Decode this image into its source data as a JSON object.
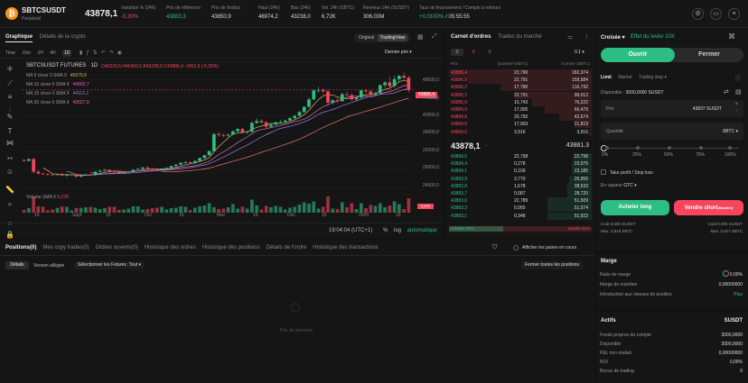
{
  "header": {
    "symbol": "SBTCSUSDT",
    "subtitle": "Perpetuel",
    "last_price": "43878,1",
    "stats": [
      {
        "label": "Variation % (24h)",
        "value": "-5,30%",
        "color": "#f6465d"
      },
      {
        "label": "Prix de référence",
        "value": "43883,3",
        "color": "#2ebd85"
      },
      {
        "label": "Prix de l'indice",
        "value": "43850,9",
        "color": "#dddddd"
      },
      {
        "label": "Haut (24h)",
        "value": "46974,2",
        "color": "#dddddd"
      },
      {
        "label": "Bas (24h)",
        "value": "43238,0",
        "color": "#dddddd"
      },
      {
        "label": "Vol. 24h (SBTC)",
        "value": "6,72K",
        "color": "#dddddd"
      },
      {
        "label": "Revenus 24h (SUSDT)",
        "value": "306,03M",
        "color": "#dddddd"
      },
      {
        "label": "Taux de financement / Compte à rebours",
        "value_rate": "+0,0100%",
        "value_timer": "/ 05:55:55"
      }
    ]
  },
  "chart_panel": {
    "tabs": [
      "Graphique",
      "Détails de la crypto"
    ],
    "views": [
      "Original",
      "TradingView"
    ],
    "intervals": [
      "Time",
      "15m",
      "1H",
      "4H",
      "1D"
    ],
    "last_price_mode": "Dernier prix",
    "legend_title": "SBTCSUSDT FUTURES · 1D",
    "ohlc": "O46239,5  H46493,5  B43238,0  C43886,4  -2452,9 (-5,29%)",
    "ma": [
      {
        "label": "MA 5 close 0 SMA 9",
        "value": "45979,9",
        "color": "#e0b252"
      },
      {
        "label": "MA 10 close 0 SMA 9",
        "value": "44892,7",
        "color": "#d96cb5"
      },
      {
        "label": "MA 15 close 0 SMA 9",
        "value": "44112,1",
        "color": "#9b7ce0"
      },
      {
        "label": "MA 30 close 0 SMA 9",
        "value": "43027,9",
        "color": "#f0756e"
      }
    ],
    "volume_label": "Volume SMA 9",
    "volume_value": "5,37K",
    "price_tag": "43886,4",
    "yticks": [
      "48000,0",
      "44000,0",
      "40000,0",
      "36000,0",
      "32000,0",
      "28000,0",
      "24000,0"
    ],
    "xticks": [
      "15",
      "Sept",
      "15",
      "Oct",
      "15",
      "Nov",
      "15",
      "Déc",
      "15",
      "2024",
      "15"
    ],
    "time": "19:04:04 (UTC+1)",
    "controls": [
      "%",
      "log",
      "automatique"
    ]
  },
  "chart_data": {
    "type": "candlestick",
    "candles": [
      [
        29000,
        29100,
        28600,
        28800
      ],
      [
        28800,
        29300,
        28700,
        29200
      ],
      [
        29200,
        29400,
        26100,
        26500
      ],
      [
        26500,
        26800,
        25900,
        26100
      ],
      [
        26100,
        26300,
        25800,
        26000
      ],
      [
        26000,
        26200,
        25700,
        25900
      ],
      [
        25900,
        26100,
        25600,
        25800
      ],
      [
        25800,
        26100,
        25700,
        26050
      ],
      [
        26050,
        26200,
        25600,
        25700
      ],
      [
        25700,
        26000,
        25400,
        25800
      ],
      [
        25800,
        26000,
        25700,
        25900
      ],
      [
        25900,
        26000,
        25300,
        25450
      ],
      [
        25450,
        25800,
        25300,
        25700
      ],
      [
        25700,
        26000,
        25600,
        25900
      ],
      [
        25900,
        26100,
        25700,
        25800
      ],
      [
        25800,
        26600,
        25700,
        26500
      ],
      [
        26500,
        26900,
        26300,
        26700
      ],
      [
        26700,
        27100,
        26500,
        26900
      ],
      [
        26900,
        27000,
        26400,
        26600
      ],
      [
        26600,
        26800,
        26300,
        26500
      ],
      [
        26500,
        26700,
        26200,
        26300
      ],
      [
        26300,
        26500,
        26100,
        26400
      ],
      [
        26400,
        26600,
        26300,
        26500
      ],
      [
        26500,
        27000,
        26400,
        26900
      ],
      [
        26900,
        27300,
        26800,
        27100
      ],
      [
        27100,
        27500,
        26900,
        27400
      ],
      [
        27400,
        27700,
        27100,
        27200
      ],
      [
        27200,
        27400,
        26900,
        27000
      ],
      [
        27000,
        27200,
        26700,
        26900
      ],
      [
        26900,
        27100,
        26800,
        27000
      ],
      [
        27000,
        27400,
        26900,
        27300
      ],
      [
        27300,
        27800,
        27200,
        27700
      ],
      [
        27700,
        28100,
        27600,
        28000
      ],
      [
        28000,
        28500,
        27900,
        28400
      ],
      [
        28400,
        28800,
        28200,
        28500
      ],
      [
        28500,
        28700,
        28100,
        28300
      ],
      [
        28300,
        28900,
        28200,
        28800
      ],
      [
        28800,
        29500,
        28700,
        29400
      ],
      [
        29400,
        30100,
        29300,
        30000
      ],
      [
        30000,
        31000,
        29900,
        30900
      ],
      [
        30900,
        34800,
        30800,
        34500
      ],
      [
        34500,
        35000,
        33900,
        34300
      ],
      [
        34300,
        34700,
        33800,
        34200
      ],
      [
        34200,
        34600,
        33900,
        34400
      ],
      [
        34400,
        35300,
        34300,
        35100
      ],
      [
        35100,
        35800,
        34900,
        35600
      ],
      [
        35600,
        35800,
        34700,
        34900
      ],
      [
        34900,
        35200,
        34500,
        35000
      ],
      [
        35000,
        37200,
        34900,
        36900
      ],
      [
        36900,
        37900,
        36600,
        37300
      ],
      [
        37300,
        37700,
        36800,
        37000
      ],
      [
        37000,
        37300,
        35600,
        36100
      ],
      [
        36100,
        36700,
        35800,
        36500
      ],
      [
        36500,
        37200,
        36300,
        37000
      ],
      [
        37000,
        37500,
        36700,
        37100
      ],
      [
        37100,
        37600,
        36900,
        37400
      ],
      [
        37400,
        38200,
        37200,
        37900
      ],
      [
        37900,
        38600,
        37700,
        38400
      ],
      [
        38400,
        39400,
        38200,
        39200
      ],
      [
        39200,
        40500,
        39000,
        40300
      ],
      [
        40300,
        42300,
        40100,
        41900
      ],
      [
        41900,
        44100,
        41700,
        43800
      ],
      [
        43800,
        44600,
        43300,
        43900
      ],
      [
        43900,
        44300,
        43200,
        43600
      ],
      [
        43600,
        44000,
        40500,
        41200
      ],
      [
        41200,
        42000,
        40800,
        41700
      ],
      [
        41700,
        42200,
        41100,
        41500
      ],
      [
        41500,
        43300,
        41400,
        43000
      ],
      [
        43000,
        43600,
        42600,
        42800
      ],
      [
        42800,
        43200,
        41500,
        41900
      ],
      [
        41900,
        42500,
        41600,
        42300
      ],
      [
        42300,
        44000,
        42100,
        43800
      ],
      [
        43800,
        44100,
        43200,
        43600
      ],
      [
        43600,
        43900,
        42600,
        42900
      ],
      [
        42900,
        43500,
        42700,
        43200
      ],
      [
        43200,
        45200,
        43000,
        44900
      ],
      [
        44900,
        45800,
        44300,
        45500
      ],
      [
        45500,
        46800,
        44200,
        44700
      ],
      [
        44700,
        47000,
        44400,
        46200
      ],
      [
        46200,
        47200,
        45500,
        46900
      ],
      [
        46900,
        47600,
        46300,
        46500
      ],
      [
        46500,
        46900,
        43300,
        43900
      ]
    ],
    "ylim": [
      22000,
      50000
    ]
  },
  "orderbook": {
    "tabs": [
      "Carnet d'ordres",
      "Trades du marché"
    ],
    "precision": "0.1",
    "headers": [
      "Prix",
      "Quantité (SBTC)",
      "Somme (SBTC)"
    ],
    "asks": [
      [
        "43888,4",
        "22,790",
        "182,374",
        1.0
      ],
      [
        "43886,9",
        "22,791",
        "159,584",
        0.87
      ],
      [
        "43886,2",
        "17,780",
        "116,792",
        0.64
      ],
      [
        "43885,1",
        "22,791",
        "99,012",
        0.54
      ],
      [
        "43885,0",
        "15,743",
        "76,222",
        0.42
      ],
      [
        "43884,9",
        "17,905",
        "60,479",
        0.33
      ],
      [
        "43884,8",
        "20,755",
        "42,574",
        0.23
      ],
      [
        "43884,5",
        "17,903",
        "21,819",
        0.12
      ],
      [
        "43884,0",
        "3,916",
        "3,916",
        0.02
      ]
    ],
    "mid_price": "43878,1",
    "mid_ref": "43881,3",
    "bids": [
      [
        "43884,5",
        "22,798",
        "22,798",
        0.13
      ],
      [
        "43884,4",
        "0,278",
        "23,075",
        0.14
      ],
      [
        "43884,1",
        "0,109",
        "23,185",
        0.14
      ],
      [
        "43883,9",
        "3,770",
        "26,955",
        0.16
      ],
      [
        "43883,8",
        "1,678",
        "28,633",
        0.17
      ],
      [
        "43883,7",
        "0,087",
        "28,720",
        0.17
      ],
      [
        "43883,6",
        "22,789",
        "51,509",
        0.31
      ],
      [
        "43883,3",
        "0,065",
        "51,574",
        0.31
      ],
      [
        "43883,1",
        "0,348",
        "51,922",
        0.31
      ]
    ],
    "buy_label": "Acheter 38%",
    "sell_label": "Vendre 62%",
    "buy_pct": 0.38
  },
  "order_panel": {
    "margin_mode": "Croisée",
    "leverage": "Effet du levier 10X",
    "open": "Ouvrir",
    "close": "Fermer",
    "types": [
      "Limit",
      "Market",
      "Trailing stop"
    ],
    "available_label": "Disponible :",
    "available_value": "3000,0000 SUSDT",
    "price_label": "Prix",
    "price_value": "43837 SUSDT",
    "qty_label": "Quantité",
    "qty_unit": "SBTC",
    "slider_marks": [
      "0%",
      "25%",
      "50%",
      "75%",
      "100%"
    ],
    "tpsl": "Take profit / Stop loss",
    "tif_label": "En vigueur",
    "tif_value": "GTC",
    "buy_btn": "Acheter long",
    "sell_btn": "Vendre short",
    "sell_tag": "(Modéré)",
    "cost_buy": "Coût 0,000 SUSDT",
    "cost_sell": "Coût 0,000 SUSDT",
    "max_buy": "Max. 0,818 SBTC",
    "max_sell": "Max. 0,817 SBTC"
  },
  "margin": {
    "title": "Marge",
    "rows": [
      {
        "label": "Ratio de marge",
        "value": "0,00%"
      },
      {
        "label": "Marge de maintien",
        "value": "0,00000000"
      },
      {
        "label": "Introduction aux niveaux de position",
        "value": "Plus"
      }
    ]
  },
  "assets": {
    "title": "Actifs",
    "currency": "SUSDT",
    "rows": [
      {
        "label": "Fonds propres du compte",
        "value": "3000,0000"
      },
      {
        "label": "Disponible",
        "value": "3000,0000"
      },
      {
        "label": "P&L non réalisé",
        "value": "0,00000000"
      },
      {
        "label": "ROI",
        "value": "0,00%"
      },
      {
        "label": "Bonus de trading",
        "value": "0"
      }
    ]
  },
  "bottom": {
    "tabs": [
      "Positions(0)",
      "Mes copy trades(0)",
      "Ordres ouverts(0)",
      "Historique des ordres",
      "Historique des positions",
      "Détails de l'ordre",
      "Historique des transactions"
    ],
    "show_all": "Afficher les paires en cours",
    "views": [
      "Détails",
      "Version allégée"
    ],
    "filter": "Sélectionner les Futures :Tout",
    "close_all": "Fermer toutes les positions",
    "empty": "Pas de données"
  }
}
